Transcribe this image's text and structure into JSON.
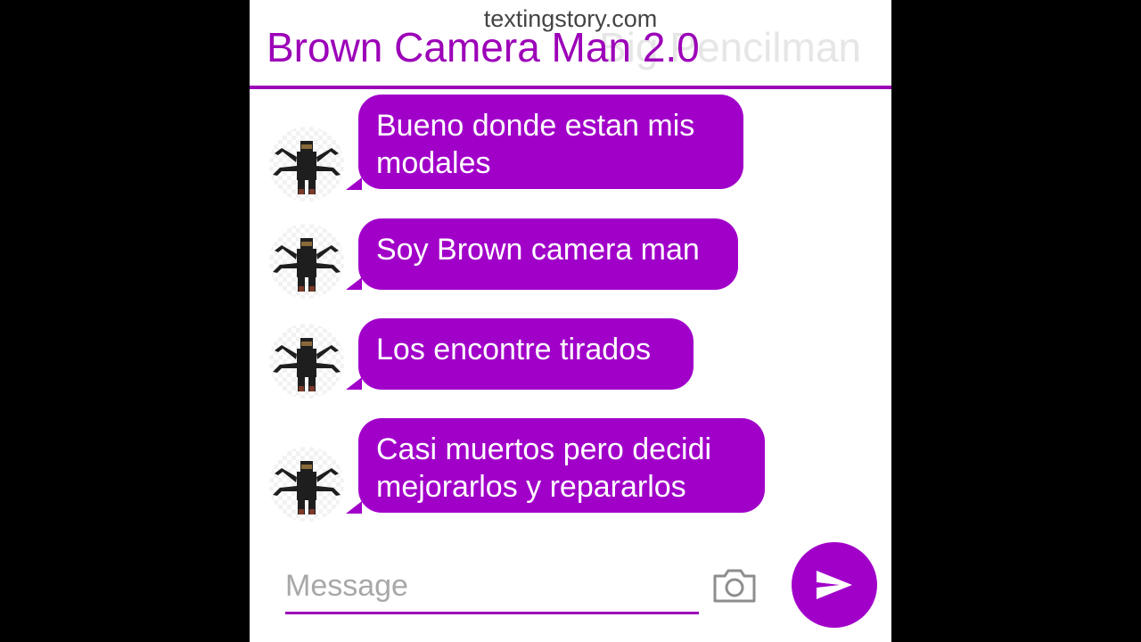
{
  "watermark": "textingstory.com",
  "header": {
    "contact_name": "Brown Camera Man 2.0",
    "ghost_name": "Big Pencilman"
  },
  "messages": [
    {
      "sender": "Brown Camera Man 2.0",
      "text": "Bueno donde estan mis\nmodales"
    },
    {
      "sender": "Brown Camera Man 2.0",
      "text": "Soy Brown camera man"
    },
    {
      "sender": "Brown Camera Man 2.0",
      "text": "Los encontre tirados"
    },
    {
      "sender": "Brown Camera Man 2.0",
      "text": "Casi muertos pero decidi\nmejorarlos y repararlos"
    }
  ],
  "composer": {
    "placeholder": "Message",
    "camera_icon": "camera-icon",
    "send_icon": "send-icon"
  },
  "colors": {
    "accent": "#a100c9",
    "bubble_text": "#ffffff",
    "background": "#ffffff",
    "letterbox": "#000000"
  }
}
